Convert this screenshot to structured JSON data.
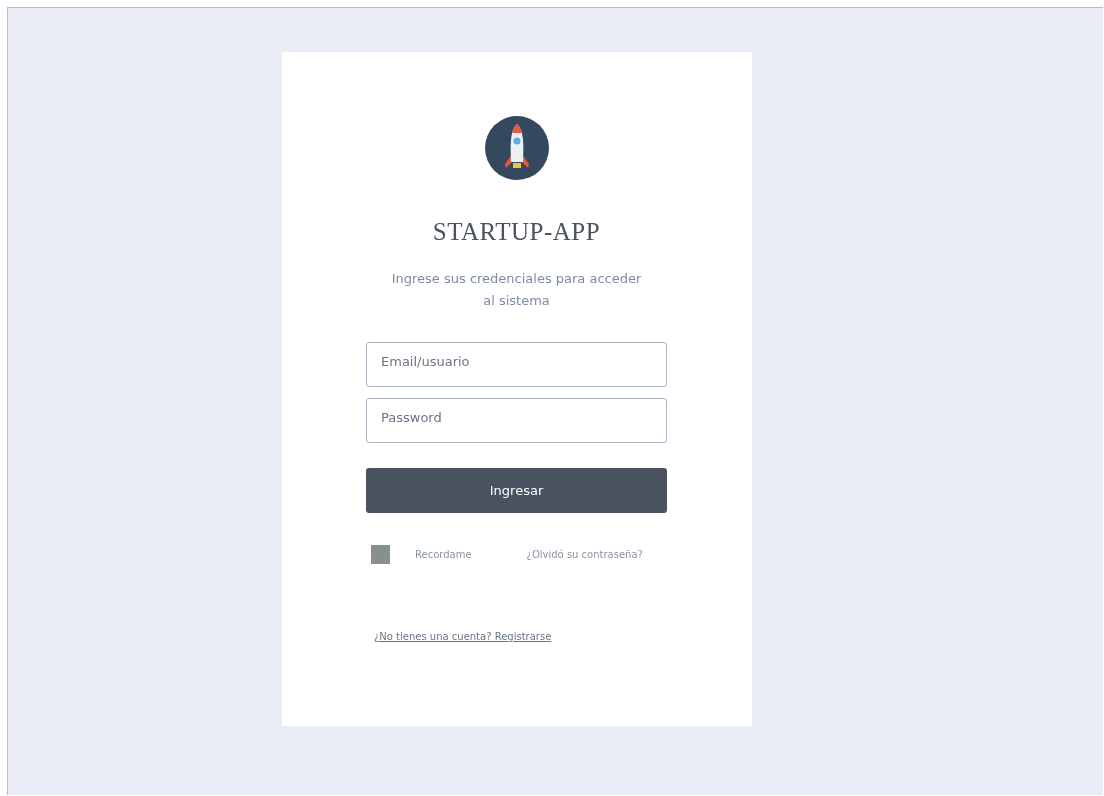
{
  "app_name": "STARTUP-APP",
  "subtitle": "Ingrese sus credenciales para acceder al sistema",
  "fields": [
    {
      "placeholder": "Email/usuario"
    },
    {
      "placeholder": "Password"
    }
  ],
  "submit_button": "Ingresar",
  "remember": {
    "label": "Recordame",
    "checked": false
  },
  "forgot_link": "¿Olvidó su contraseña?",
  "register_link": "¿No tienes una cuenta? Registrarse"
}
